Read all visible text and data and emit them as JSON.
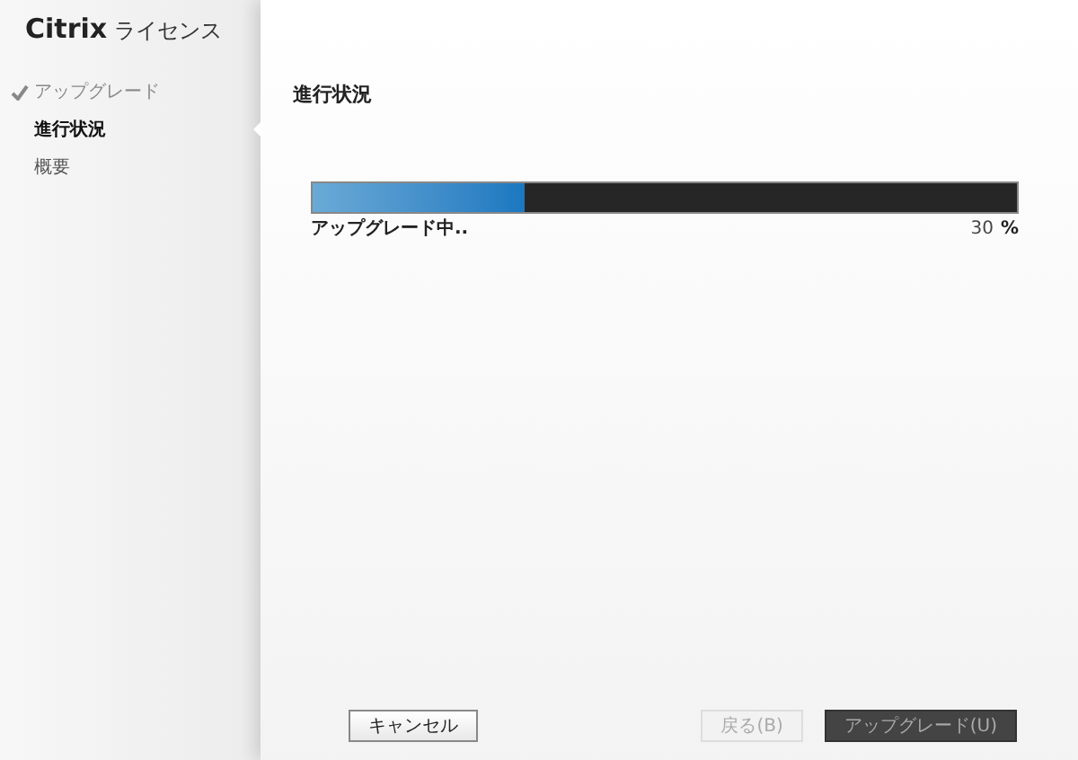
{
  "app_title": {
    "brand": "Citrix",
    "product": "ライセンス"
  },
  "steps": [
    {
      "label": "アップグレード",
      "completed": true,
      "selected": false
    },
    {
      "label": "進行状況",
      "completed": false,
      "selected": true
    },
    {
      "label": "概要",
      "completed": false,
      "selected": false
    }
  ],
  "heading": "進行状況",
  "progress": {
    "level": 0.3,
    "caption": "アップグレード中..",
    "value": "30",
    "unit": "%"
  },
  "buttons": [
    {
      "label": "キャンセル",
      "kind": "light",
      "disabled": false
    },
    {
      "label": "戻る(B)",
      "kind": "light",
      "disabled": true
    },
    {
      "label": "アップグレード(U)",
      "kind": "dark",
      "disabled": true
    }
  ]
}
